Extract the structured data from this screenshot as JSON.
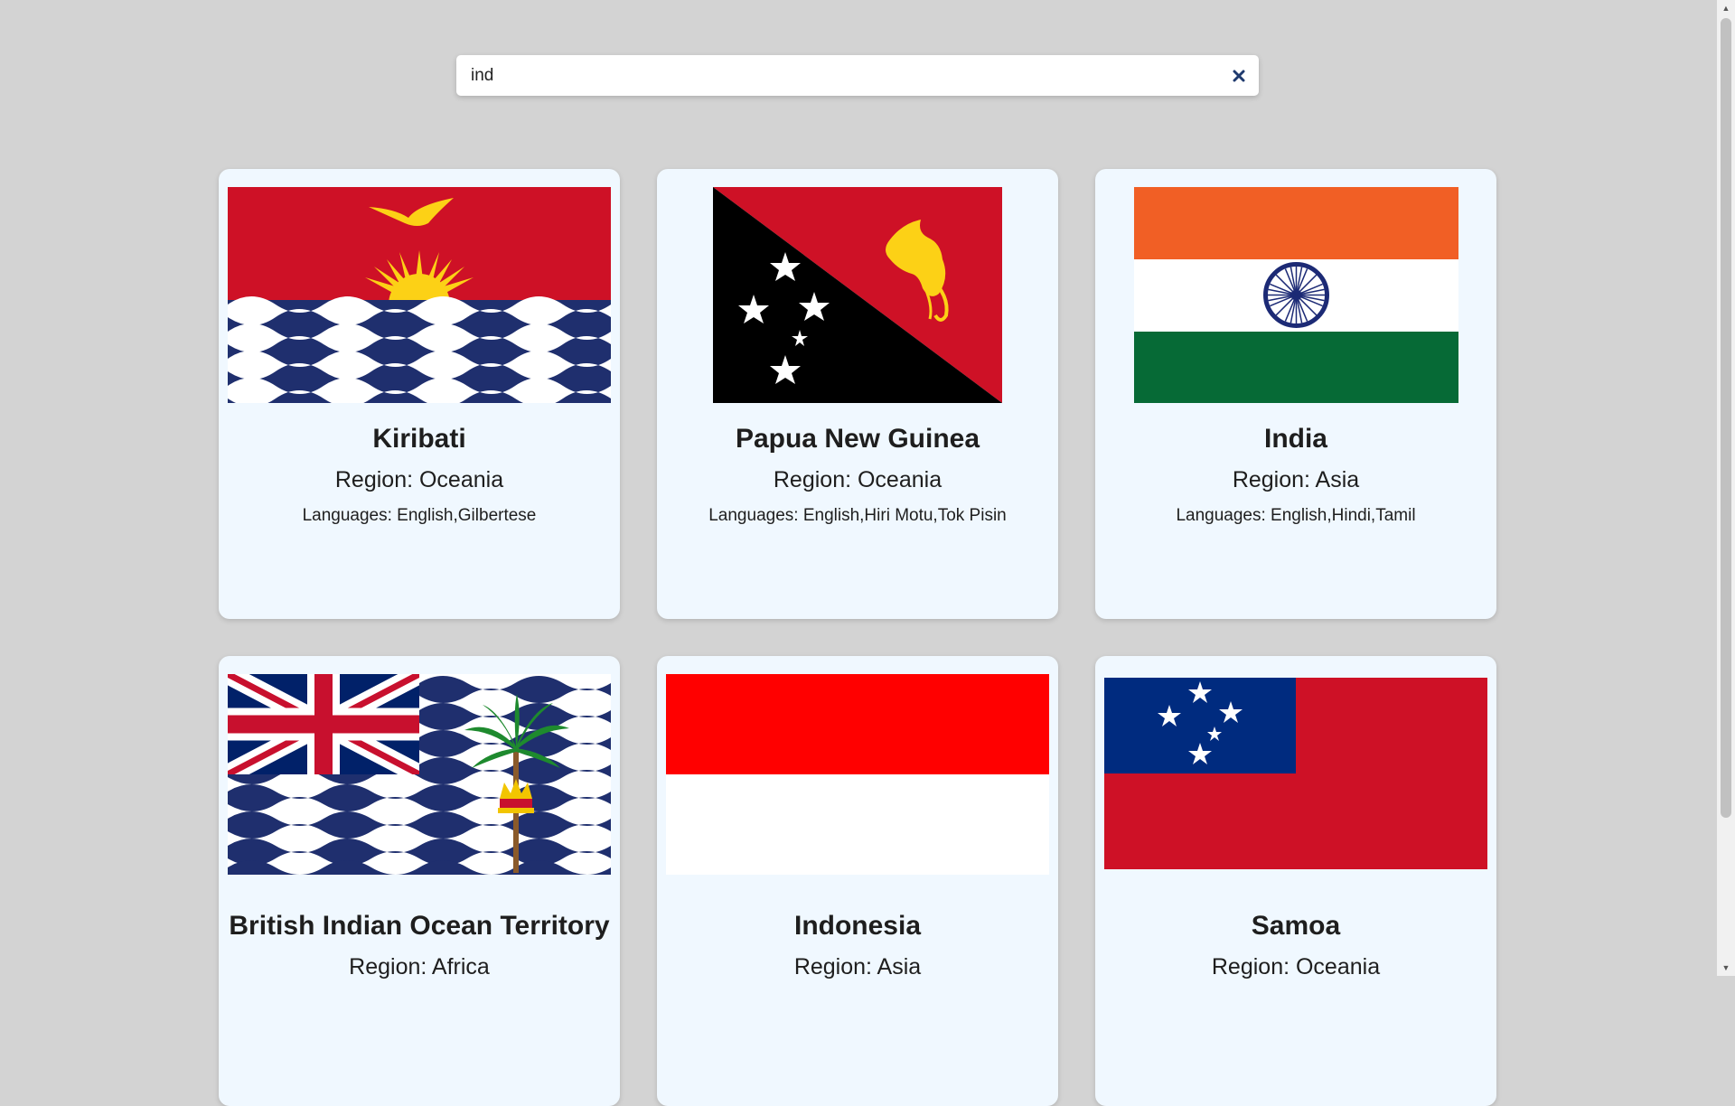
{
  "search": {
    "value": "ind",
    "placeholder": ""
  },
  "clear_icon": "close-icon",
  "cards": [
    {
      "name": "Kiribati",
      "region": "Region: Oceania",
      "languages": "Languages: English,Gilbertese",
      "flag": "kiribati-flag"
    },
    {
      "name": "Papua New Guinea",
      "region": "Region: Oceania",
      "languages": "Languages: English,Hiri Motu,Tok Pisin",
      "flag": "papua-new-guinea-flag"
    },
    {
      "name": "India",
      "region": "Region: Asia",
      "languages": "Languages: English,Hindi,Tamil",
      "flag": "india-flag"
    },
    {
      "name": "British Indian Ocean Territory",
      "region": "Region: Africa",
      "languages": "",
      "flag": "british-indian-ocean-territory-flag"
    },
    {
      "name": "Indonesia",
      "region": "Region: Asia",
      "languages": "",
      "flag": "indonesia-flag"
    },
    {
      "name": "Samoa",
      "region": "Region: Oceania",
      "languages": "",
      "flag": "samoa-flag"
    }
  ],
  "colors": {
    "page_bg": "#d3d3d3",
    "card_bg": "#f0f8ff",
    "clear_icon": "#1f3a6e"
  }
}
